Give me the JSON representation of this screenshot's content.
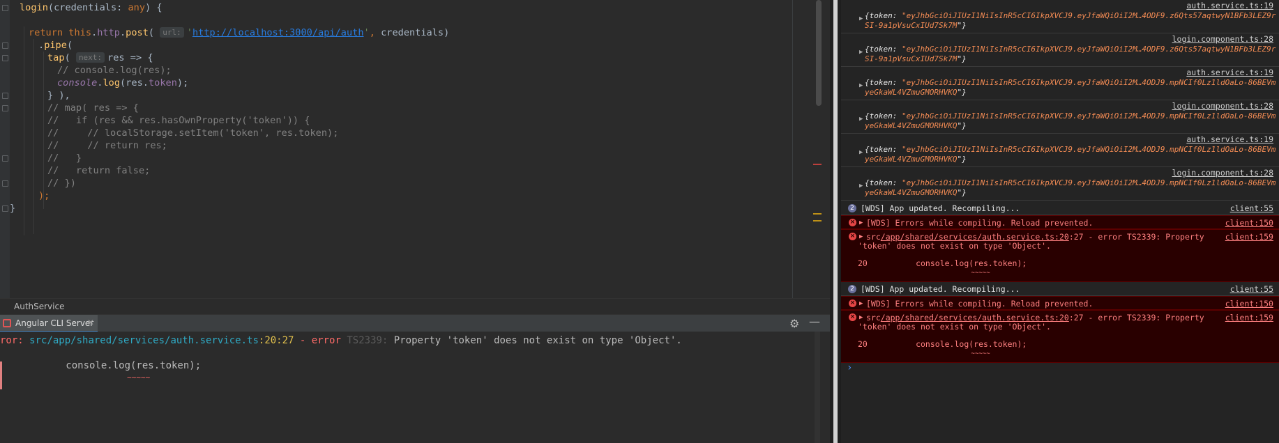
{
  "editor": {
    "lines": [
      {
        "parts": [
          [
            "fn",
            "login"
          ],
          [
            "",
            "(credentials: "
          ],
          [
            "type",
            "any"
          ],
          [
            "",
            ") {"
          ]
        ]
      },
      {
        "parts": []
      },
      {
        "parts": [
          [
            "kw",
            "return "
          ],
          [
            "kw",
            "this"
          ],
          [
            "",
            "."
          ],
          [
            "field",
            "http"
          ],
          [
            "",
            "."
          ],
          [
            "fn",
            "post"
          ],
          [
            "",
            "( "
          ]
        ],
        "hint": "url:",
        "after": [
          [
            "str",
            "'"
          ],
          [
            "url",
            "http://localhost:3000/api/auth"
          ],
          [
            "str",
            "'"
          ],
          [
            "kw",
            ", "
          ],
          [
            "",
            "credentials)"
          ]
        ]
      },
      {
        "parts": [
          [
            "",
            "."
          ],
          [
            "fn",
            "pipe"
          ],
          [
            "",
            "("
          ]
        ]
      },
      {
        "parts": [
          [
            "fn",
            "tap"
          ],
          [
            "",
            "( "
          ]
        ],
        "hint": "next:",
        "after": [
          [
            "",
            "res => {"
          ]
        ]
      },
      {
        "parts": [
          [
            "cmt",
            "// console.log(res);"
          ]
        ]
      },
      {
        "parts": [
          [
            "purple",
            "console"
          ],
          [
            "",
            "."
          ],
          [
            "fn",
            "log"
          ],
          [
            "",
            "(res."
          ],
          [
            "field",
            "token"
          ],
          [
            "",
            ");"
          ]
        ]
      },
      {
        "parts": [
          [
            "",
            "} ),"
          ]
        ]
      },
      {
        "parts": [
          [
            "cmt",
            "// map( res => {"
          ]
        ]
      },
      {
        "parts": [
          [
            "cmt",
            "//   if (res && res.hasOwnProperty('token')) {"
          ]
        ]
      },
      {
        "parts": [
          [
            "cmt",
            "//     // localStorage.setItem('token', res.token);"
          ]
        ]
      },
      {
        "parts": [
          [
            "cmt",
            "//     // return res;"
          ]
        ]
      },
      {
        "parts": [
          [
            "cmt",
            "//   }"
          ]
        ]
      },
      {
        "parts": [
          [
            "cmt",
            "//   return false;"
          ]
        ]
      },
      {
        "parts": [
          [
            "cmt",
            "// })"
          ]
        ]
      },
      {
        "parts": [
          [
            "kw",
            ");"
          ]
        ]
      },
      {
        "parts": [
          [
            "",
            "}"
          ]
        ]
      }
    ],
    "breadcrumb": "AuthService"
  },
  "run_panel": {
    "tab_label": "Angular CLI Server",
    "close_glyph": "✕",
    "gear_glyph": "⚙",
    "minimize_glyph": "—",
    "line1": {
      "prefix": "ror: ",
      "path": "src/app/shared/services/auth.service.ts",
      "pos": ":20:27",
      "dash": " - ",
      "error_word": "error",
      "code": " TS2339:",
      "message": " Property 'token' does not exist on type 'Object'."
    },
    "line2": "          console.log(res.token);",
    "line3": "                          ~~~~~"
  },
  "devtools": {
    "log_entries": [
      {
        "source": "auth.service.ts:19",
        "line1": "{token: \"eyJhbGciOiJIUzI1NiIsInR5cCI6IkpXVCJ9.eyJfaWQiOiI2M…4ODF9.z6Qts57aqtwyN1BFb3LEZ9r",
        "line2": "SI-9a1pVsuCxIUd7Sk7M\"}"
      },
      {
        "source": "login.component.ts:28",
        "line1": "{token: \"eyJhbGciOiJIUzI1NiIsInR5cCI6IkpXVCJ9.eyJfaWQiOiI2M…4ODF9.z6Qts57aqtwyN1BFb3LEZ9r",
        "line2": "SI-9a1pVsuCxIUd7Sk7M\"}"
      },
      {
        "source": "auth.service.ts:19",
        "line1": "{token: \"eyJhbGciOiJIUzI1NiIsInR5cCI6IkpXVCJ9.eyJfaWQiOiI2M…4ODJ9.mpNCIf0Lz1ldOaLo-86BEVm",
        "line2": "yeGkaWL4VZmuGMORHVKQ\"}"
      },
      {
        "source": "login.component.ts:28",
        "line1": "{token: \"eyJhbGciOiJIUzI1NiIsInR5cCI6IkpXVCJ9.eyJfaWQiOiI2M…4ODJ9.mpNCIf0Lz1ldOaLo-86BEVm",
        "line2": "yeGkaWL4VZmuGMORHVKQ\"}"
      },
      {
        "source": "auth.service.ts:19",
        "line1": "{token: \"eyJhbGciOiJIUzI1NiIsInR5cCI6IkpXVCJ9.eyJfaWQiOiI2M…4ODJ9.mpNCIf0Lz1ldOaLo-86BEVm",
        "line2": "yeGkaWL4VZmuGMORHVKQ\"}"
      },
      {
        "source": "login.component.ts:28",
        "line1": "{token: \"eyJhbGciOiJIUzI1NiIsInR5cCI6IkpXVCJ9.eyJfaWQiOiI2M…4ODJ9.mpNCIf0Lz1ldOaLo-86BEVm",
        "line2": "yeGkaWL4VZmuGMORHVKQ\"}"
      }
    ],
    "groups": [
      {
        "count": "2",
        "info_text": "[WDS] App updated. Recompiling...",
        "info_src": "client:55",
        "err1_text": "[WDS] Errors while compiling. Reload prevented.",
        "err1_src": "client:150",
        "err2_prefix": "src",
        "err2_path": "/app/shared/services/auth.service.ts:20",
        "err2_rest": ":27 - error TS2339: Property",
        "err2_line2": "'token' does not exist on type 'Object'.",
        "err2_code": "20          console.log(res.token);",
        "err2_tilde": "                              ~~~~~",
        "err2_src": "client:159"
      },
      {
        "count": "2",
        "info_text": "[WDS] App updated. Recompiling...",
        "info_src": "client:55",
        "err1_text": "[WDS] Errors while compiling. Reload prevented.",
        "err1_src": "client:150",
        "err2_prefix": "src",
        "err2_path": "/app/shared/services/auth.service.ts:20",
        "err2_rest": ":27 - error TS2339: Property",
        "err2_line2": "'token' does not exist on type 'Object'.",
        "err2_code": "20          console.log(res.token);",
        "err2_tilde": "                              ~~~~~",
        "err2_src": "client:159"
      }
    ],
    "prompt_glyph": "›"
  }
}
